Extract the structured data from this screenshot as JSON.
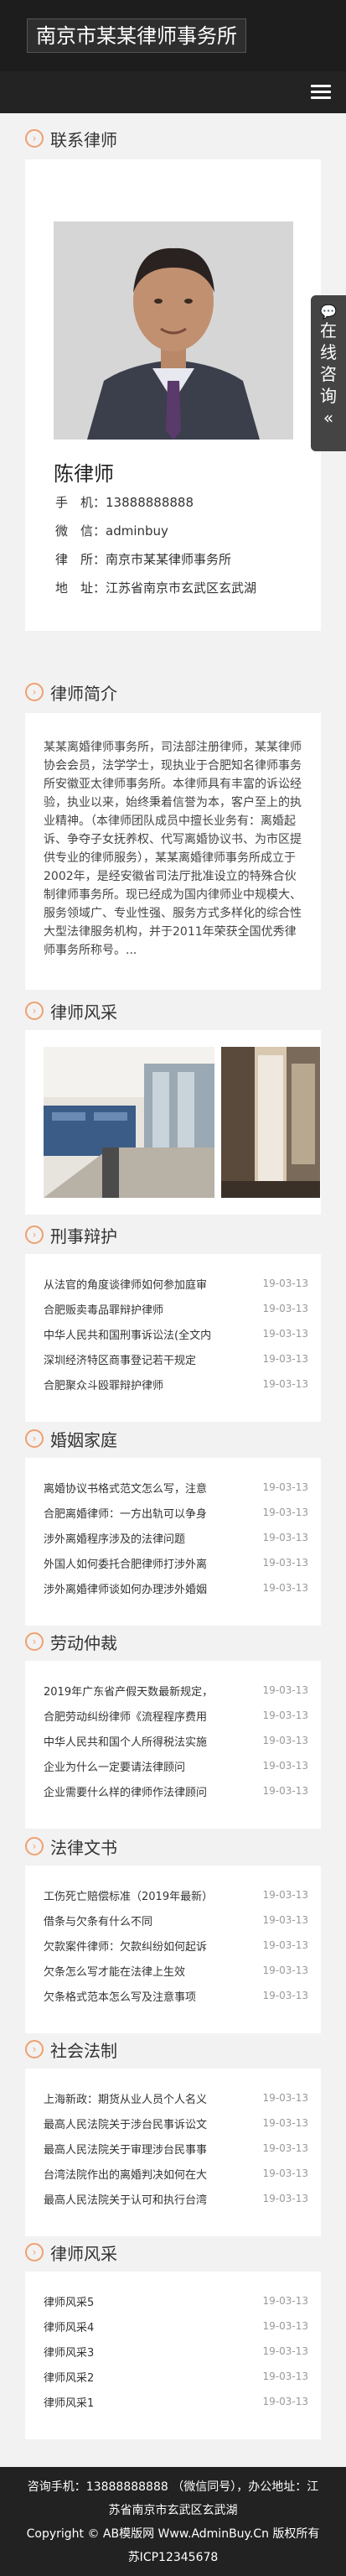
{
  "site": {
    "logo": "南京市某某律师事务所"
  },
  "contact": {
    "title": "联系律师",
    "name": "陈律师",
    "rows": [
      {
        "label": "手　机：",
        "value": "13888888888"
      },
      {
        "label": "微　信：",
        "value": "adminbuy"
      },
      {
        "label": "律　所：",
        "value": "南京市某某律师事务所"
      },
      {
        "label": "地　址：",
        "value": "江苏省南京市玄武区玄武湖"
      }
    ]
  },
  "float_tab": {
    "label_chars": [
      "在",
      "线",
      "咨",
      "询"
    ],
    "collapse": "«"
  },
  "intro": {
    "title": "律师简介",
    "text": "某某离婚律师事务所，司法部注册律师，某某律师协会会员，法学学士，现执业于合肥知名律师事务所安徽亚太律师事务所。本律师具有丰富的诉讼经验，执业以来，始终秉着信誉为本，客户至上的执业精神。（本律师团队成员中擅长业务有：离婚起诉、争夺子女抚养权、代写离婚协议书、为市区提供专业的律师服务），某某离婚律师事务所成立于2002年，是经安徽省司法厅批准设立的特殊合伙制律师事务所。现已经成为国内律师业中规模大、服务领域广、专业性强、服务方式多样化的综合性大型法律服务机构，并于2011年荣获全国优秀律师事务所称号。..."
  },
  "style1": {
    "title": "律师风采"
  },
  "criminal": {
    "title": "刑事辩护",
    "items": [
      {
        "t": "从法官的角度谈律师如何参加庭审",
        "d": "19-03-13"
      },
      {
        "t": "合肥贩卖毒品罪辩护律师",
        "d": "19-03-13"
      },
      {
        "t": "中华人民共和国刑事诉讼法(全文内",
        "d": "19-03-13"
      },
      {
        "t": "深圳经济特区商事登记若干规定",
        "d": "19-03-13"
      },
      {
        "t": "合肥聚众斗殴罪辩护律师",
        "d": "19-03-13"
      }
    ]
  },
  "family": {
    "title": "婚姻家庭",
    "items": [
      {
        "t": "离婚协议书格式范文怎么写，注意",
        "d": "19-03-13"
      },
      {
        "t": "合肥离婚律师：一方出轨可以争身",
        "d": "19-03-13"
      },
      {
        "t": "涉外离婚程序涉及的法律问题",
        "d": "19-03-13"
      },
      {
        "t": "外国人如何委托合肥律师打涉外离",
        "d": "19-03-13"
      },
      {
        "t": "涉外离婚律师谈如何办理涉外婚姻",
        "d": "19-03-13"
      }
    ]
  },
  "labor": {
    "title": "劳动仲裁",
    "items": [
      {
        "t": "2019年广东省产假天数最新规定，",
        "d": "19-03-13"
      },
      {
        "t": "合肥劳动纠纷律师《流程程序费用",
        "d": "19-03-13"
      },
      {
        "t": "中华人民共和国个人所得税法实施",
        "d": "19-03-13"
      },
      {
        "t": "企业为什么一定要请法律顾问",
        "d": "19-03-13"
      },
      {
        "t": "企业需要什么样的律师作法律顾问",
        "d": "19-03-13"
      }
    ]
  },
  "docs": {
    "title": "法律文书",
    "items": [
      {
        "t": "工伤死亡赔偿标准（2019年最新）",
        "d": "19-03-13"
      },
      {
        "t": "借条与欠条有什么不同",
        "d": "19-03-13"
      },
      {
        "t": "欠款案件律师：欠款纠纷如何起诉",
        "d": "19-03-13"
      },
      {
        "t": "欠条怎么写才能在法律上生效",
        "d": "19-03-13"
      },
      {
        "t": "欠条格式范本怎么写及注意事项",
        "d": "19-03-13"
      }
    ]
  },
  "society": {
    "title": "社会法制",
    "items": [
      {
        "t": "上海新政：期货从业人员个人名义",
        "d": "19-03-13"
      },
      {
        "t": "最高人民法院关于涉台民事诉讼文",
        "d": "19-03-13"
      },
      {
        "t": "最高人民法院关于审理涉台民事事",
        "d": "19-03-13"
      },
      {
        "t": "台湾法院作出的离婚判决如何在大",
        "d": "19-03-13"
      },
      {
        "t": "最高人民法院关于认可和执行台湾",
        "d": "19-03-13"
      }
    ]
  },
  "style2": {
    "title": "律师风采",
    "items": [
      {
        "t": "律师风采5",
        "d": "19-03-13"
      },
      {
        "t": "律师风采4",
        "d": "19-03-13"
      },
      {
        "t": "律师风采3",
        "d": "19-03-13"
      },
      {
        "t": "律师风采2",
        "d": "19-03-13"
      },
      {
        "t": "律师风采1",
        "d": "19-03-13"
      }
    ]
  },
  "footer": {
    "line1": "咨询手机：13888888888 （微信同号），办公地址：江",
    "line2": "苏省南京市玄武区玄武湖",
    "line3": "Copyright © AB模版网 Www.AdminBuy.Cn 版权所有",
    "line4": "苏ICP12345678"
  }
}
